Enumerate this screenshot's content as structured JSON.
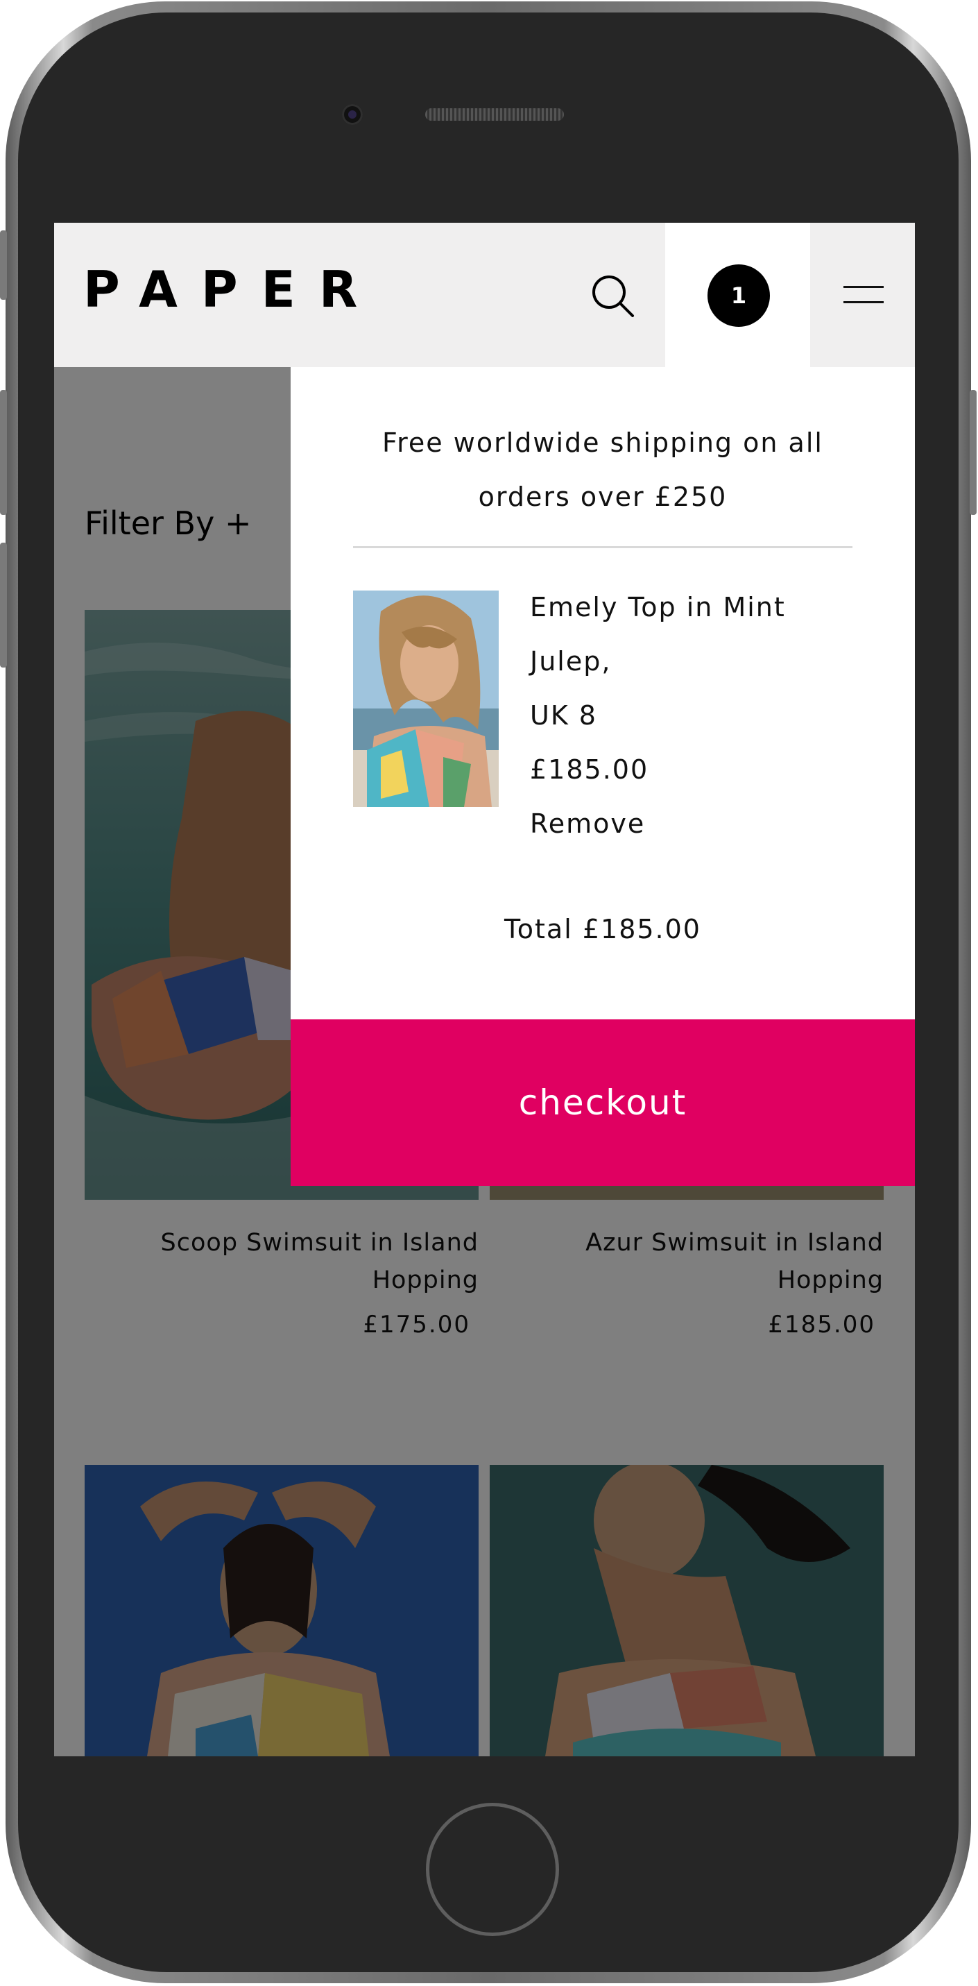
{
  "header": {
    "logo": "PAPER",
    "cart_count": "1"
  },
  "filter": {
    "label": "Filter By +"
  },
  "products": [
    {
      "title_line1": "Scoop Swimsuit in Island",
      "title_line2": "Hopping",
      "price": "£175.00"
    },
    {
      "title_line1": "Azur Swimsuit in Island",
      "title_line2": "Hopping",
      "price": "£185.00"
    }
  ],
  "cart": {
    "shipping_line1": "Free worldwide shipping on all",
    "shipping_line2": "orders over £250",
    "item": {
      "name_line1": "Emely Top in Mint",
      "name_line2": "Julep,",
      "size": "UK 8",
      "price": "£185.00",
      "remove_label": "Remove"
    },
    "total": "Total £185.00",
    "checkout_label": "checkout"
  },
  "colors": {
    "accent": "#e00061",
    "header_bg": "#f0efef"
  },
  "icons": [
    "search-icon",
    "menu-icon",
    "cart-badge"
  ]
}
